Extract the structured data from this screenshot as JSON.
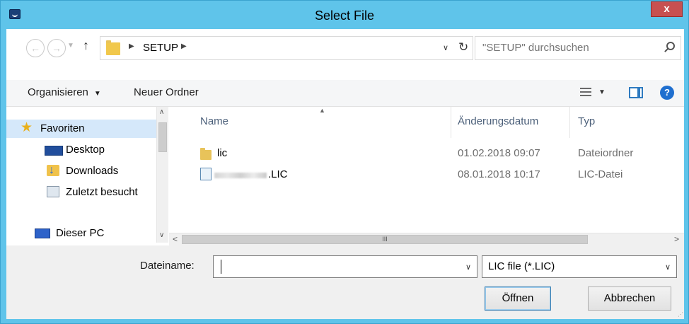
{
  "window": {
    "title": "Select File",
    "close_label": "x"
  },
  "address": {
    "back_glyph": "←",
    "forward_glyph": "→",
    "crumb": "SETUP",
    "search_placeholder": "\"SETUP\" durchsuchen"
  },
  "toolbar": {
    "organize_label": "Organisieren",
    "new_folder_label": "Neuer Ordner",
    "help_glyph": "?"
  },
  "nav": {
    "items": [
      {
        "label": "Favoriten",
        "icon": "star-icon"
      },
      {
        "label": "Desktop",
        "icon": "desktop-icon"
      },
      {
        "label": "Downloads",
        "icon": "downloads-icon"
      },
      {
        "label": "Zuletzt besucht",
        "icon": "recent-places-icon"
      },
      {
        "label": "Dieser PC",
        "icon": "computer-icon"
      }
    ]
  },
  "files": {
    "columns": [
      "Name",
      "Änderungsdatum",
      "Typ"
    ],
    "rows": [
      {
        "name": "lic",
        "date": "01.02.2018 09:07",
        "type": "Dateiordner",
        "icon": "folder-icon"
      },
      {
        "name": ".LIC",
        "date": "08.01.2018 10:17",
        "type": "LIC-Datei",
        "icon": "lic-file-icon"
      }
    ],
    "scroll_thumb_glyph": "III"
  },
  "bottom": {
    "filename_label": "Dateiname:",
    "filename_value": "",
    "filetype_value": "LIC file (*.LIC)",
    "open_label": "Öffnen",
    "cancel_label": "Abbrechen"
  },
  "colors": {
    "titlebar": "#5fc4ea",
    "close": "#c75050",
    "selected_nav": "#d5e8fa"
  }
}
